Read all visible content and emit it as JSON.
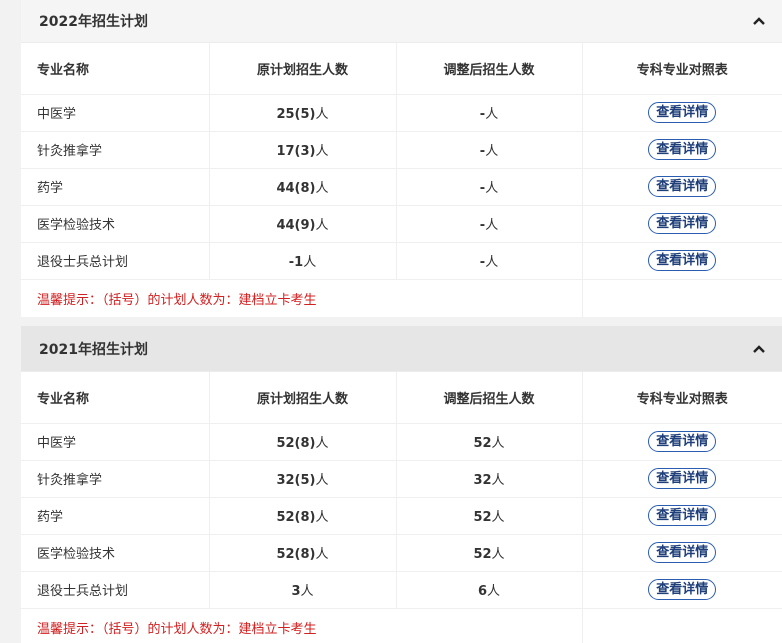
{
  "columns": [
    "专业名称",
    "原计划招生人数",
    "调整后招生人数",
    "专科专业对照表"
  ],
  "button_label": "查看详情",
  "tip": "温馨提示：（括号）的计划人数为：建档立卡考生",
  "caret_icon": "chevron-up-icon",
  "sections": [
    {
      "title": "2022年招生计划",
      "rows": [
        {
          "name": "中医学",
          "orig_num": "25(5)",
          "orig_unit": "人",
          "adj_num": "-",
          "adj_unit": "人"
        },
        {
          "name": "针灸推拿学",
          "orig_num": "17(3)",
          "orig_unit": "人",
          "adj_num": "-",
          "adj_unit": "人"
        },
        {
          "name": "药学",
          "orig_num": "44(8)",
          "orig_unit": "人",
          "adj_num": "-",
          "adj_unit": "人"
        },
        {
          "name": "医学检验技术",
          "orig_num": "44(9)",
          "orig_unit": "人",
          "adj_num": "-",
          "adj_unit": "人"
        },
        {
          "name": "退役士兵总计划",
          "orig_num": "-1",
          "orig_unit": "人",
          "adj_num": "-",
          "adj_unit": "人"
        }
      ]
    },
    {
      "title": "2021年招生计划",
      "rows": [
        {
          "name": "中医学",
          "orig_num": "52(8)",
          "orig_unit": "人",
          "adj_num": "52",
          "adj_unit": "人"
        },
        {
          "name": "针灸推拿学",
          "orig_num": "32(5)",
          "orig_unit": "人",
          "adj_num": "32",
          "adj_unit": "人"
        },
        {
          "name": "药学",
          "orig_num": "52(8)",
          "orig_unit": "人",
          "adj_num": "52",
          "adj_unit": "人"
        },
        {
          "name": "医学检验技术",
          "orig_num": "52(8)",
          "orig_unit": "人",
          "adj_num": "52",
          "adj_unit": "人"
        },
        {
          "name": "退役士兵总计划",
          "orig_num": "3",
          "orig_unit": "人",
          "adj_num": "6",
          "adj_unit": "人"
        }
      ]
    }
  ],
  "colors": {
    "accent": "#2a5db0",
    "tip": "#d21f1f",
    "header_bg": "#f5f5f5"
  }
}
